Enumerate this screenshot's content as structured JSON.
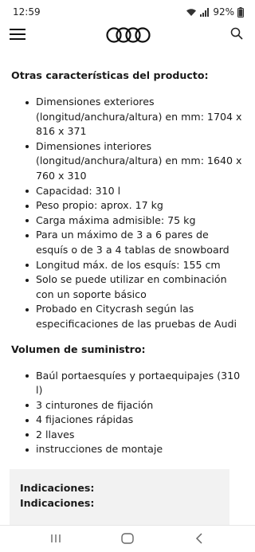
{
  "status_bar": {
    "time": "12:59",
    "battery": "92%",
    "icons": [
      "wifi-icon",
      "signal-icon",
      "battery-icon"
    ]
  },
  "header": {
    "menu_icon": "hamburger-menu-icon",
    "logo": "audi-rings-logo",
    "search_icon": "search-icon"
  },
  "features": {
    "title": "Otras características del producto:",
    "items": [
      "Dimensiones exteriores (longitud/anchura/altura) en mm: 1704 x 816 x 371",
      "Dimensiones interiores (longitud/anchura/altura) en mm: 1640 x 760 x 310",
      "Capacidad: 310 l",
      "Peso propio: aprox. 17 kg",
      "Carga máxima admisible: 75 kg",
      "Para un máximo de 3 a 6 pares de esquís o de 3 a 4 tablas de snowboard",
      "Longitud máx. de los esquís: 155 cm",
      "Solo se puede utilizar en combinación con un soporte básico",
      "Probado en Citycrash según las especificaciones de las pruebas de Audi"
    ]
  },
  "delivery": {
    "title": "Volumen de suministro:",
    "items": [
      "Baúl portaesquíes y portaequipajes (310 l)",
      "3 cinturones de fijación",
      "4 fijaciones rápidas",
      "2 llaves",
      "instrucciones de montaje"
    ]
  },
  "notes": {
    "line1": "Indicaciones:",
    "line2": "Indicaciones:"
  },
  "nav_bar": {
    "icons": [
      "recent-apps-icon",
      "home-icon",
      "back-icon"
    ]
  }
}
